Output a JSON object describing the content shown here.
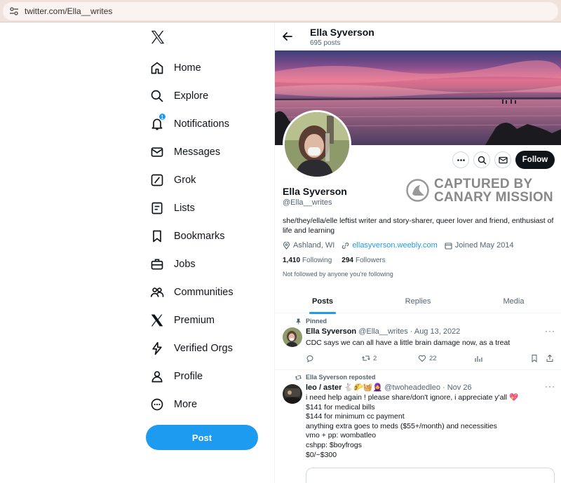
{
  "browser": {
    "url": "twitter.com/Ella__writes"
  },
  "colors": {
    "accent": "#1d9bf0",
    "text": "#0f1419",
    "muted": "#536471",
    "follow_bg": "#0f1419"
  },
  "nav": {
    "items": [
      {
        "label": "Home",
        "icon": "home-icon"
      },
      {
        "label": "Explore",
        "icon": "search-icon"
      },
      {
        "label": "Notifications",
        "icon": "bell-icon",
        "badge": "1"
      },
      {
        "label": "Messages",
        "icon": "envelope-icon"
      },
      {
        "label": "Grok",
        "icon": "grok-icon"
      },
      {
        "label": "Lists",
        "icon": "list-icon"
      },
      {
        "label": "Bookmarks",
        "icon": "bookmark-icon"
      },
      {
        "label": "Jobs",
        "icon": "briefcase-icon"
      },
      {
        "label": "Communities",
        "icon": "people-icon"
      },
      {
        "label": "Premium",
        "icon": "x-icon"
      },
      {
        "label": "Verified Orgs",
        "icon": "lightning-icon"
      },
      {
        "label": "Profile",
        "icon": "person-icon"
      },
      {
        "label": "More",
        "icon": "more-circle-icon"
      }
    ],
    "post_label": "Post"
  },
  "header": {
    "name": "Ella Syverson",
    "posts_count": "695 posts"
  },
  "profile": {
    "name": "Ella Syverson",
    "handle": "@Ella__writes",
    "bio": "she/they/ella/elle leftist writer and story-sharer, queer lover and friend, enthusiast of life and learning",
    "location": "Ashland, WI",
    "website": "ellasyverson.weebly.com",
    "joined": "Joined May 2014",
    "following_count": "1,410",
    "following_label": "Following",
    "followers_count": "294",
    "followers_label": "Followers",
    "not_followed": "Not followed by anyone you're following",
    "follow_label": "Follow"
  },
  "watermark": {
    "line1": "CAPTURED BY",
    "line2": "CANARY MISSION"
  },
  "tabs": [
    {
      "label": "Posts"
    },
    {
      "label": "Replies"
    },
    {
      "label": "Media"
    }
  ],
  "tweets": [
    {
      "context": "Pinned",
      "name": "Ella Syverson",
      "handle_date": "@Ella__writes · Aug 13, 2022",
      "text": "CDC says we can all have a little brain damage now, as a treat",
      "retweets": "2",
      "likes": "22"
    },
    {
      "context": "Ella Syverson reposted",
      "name": "leo / aster 🐇🌮🧺🧕",
      "handle_date": "@twoheadedleo · Nov 26",
      "text": "i need help again ! please share/don't ignore, i appreciate y'all 💖\n$141 for medical bills\n$144 for minimum cc payment\nanything extra goes to meds ($55+/month) and necessities\nvmo + pp: wombatleo\ncshpp: $boyfrogs\n$0/~$300"
    }
  ]
}
